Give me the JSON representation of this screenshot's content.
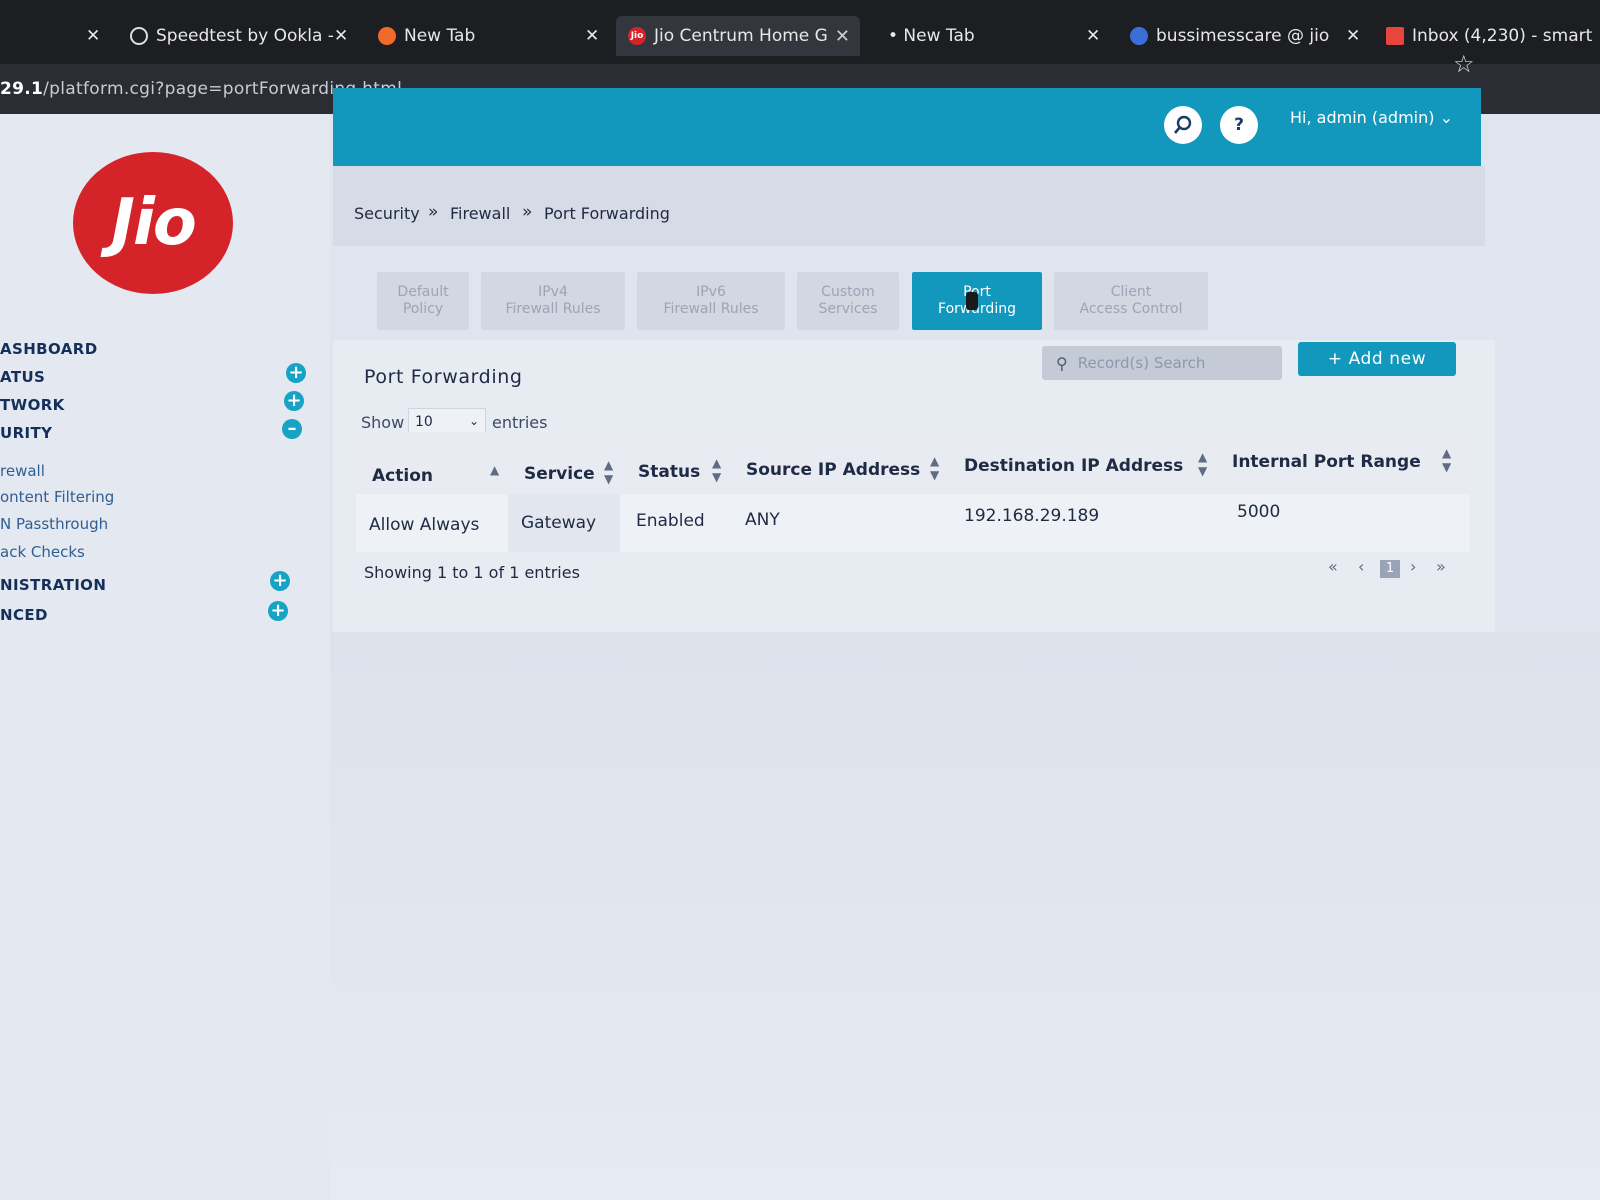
{
  "browser": {
    "tabs": [
      {
        "title": "Speedtest by Ookla -",
        "favicon": "speedometer-icon"
      },
      {
        "title": "New Tab",
        "favicon": "firefox-icon"
      },
      {
        "title": "Jio Centrum Home G",
        "favicon": "jio-icon",
        "fav_text": "Jio",
        "active": true
      },
      {
        "title": "• New Tab"
      },
      {
        "title": "bussimesscare @ jio",
        "favicon": "search-icon"
      },
      {
        "title": "Inbox (4,230) - smart",
        "favicon": "gmail-icon"
      }
    ],
    "close_glyph": "✕",
    "url_host": "29.1",
    "url_path": "/platform.cgi?page=portForwarding.html"
  },
  "header": {
    "help_label": "?",
    "user_label": "Hi, admin (admin) ⌄"
  },
  "logo_text": "Jio",
  "sidebar": {
    "items": [
      {
        "label": "ASHBOARD"
      },
      {
        "label": "ATUS"
      },
      {
        "label": "TWORK"
      },
      {
        "label": "URITY"
      },
      {
        "label": "rewall"
      },
      {
        "label": "ontent Filtering"
      },
      {
        "label": "N Passthrough"
      },
      {
        "label": "ack Checks"
      },
      {
        "label": "NISTRATION"
      },
      {
        "label": "NCED"
      }
    ],
    "expand_glyph": "+",
    "collapse_glyph": "–"
  },
  "breadcrumb": {
    "items": [
      "Security",
      "Firewall",
      "Port Forwarding"
    ],
    "separator": "»"
  },
  "subtabs": [
    {
      "line1": "Default",
      "line2": "Policy"
    },
    {
      "line1": "IPv4",
      "line2": "Firewall Rules"
    },
    {
      "line1": "IPv6",
      "line2": "Firewall Rules"
    },
    {
      "line1": "Custom",
      "line2": "Services"
    },
    {
      "line1": "Port",
      "line2": "Forwarding",
      "active": true
    },
    {
      "line1": "Client",
      "line2": "Access Control"
    }
  ],
  "panel": {
    "title": "Port Forwarding",
    "search_placeholder": "Record(s) Search",
    "add_label": "+ Add new",
    "show_label": "Show",
    "page_size": "10",
    "entries_label": "entries"
  },
  "table": {
    "columns": [
      "Action",
      "Service",
      "Status",
      "Source IP Address",
      "Destination IP Address",
      "Internal Port Range"
    ],
    "rows": [
      [
        "Allow Always",
        "Gateway",
        "Enabled",
        "ANY",
        "192.168.29.189",
        "5000"
      ]
    ]
  },
  "footer": {
    "showing": "Showing 1 to 1 of 1 entries",
    "pages": [
      "«",
      "‹",
      "1",
      "›",
      "»"
    ]
  },
  "colors": {
    "accent": "#1298bc",
    "brand_red": "#d4242a"
  }
}
